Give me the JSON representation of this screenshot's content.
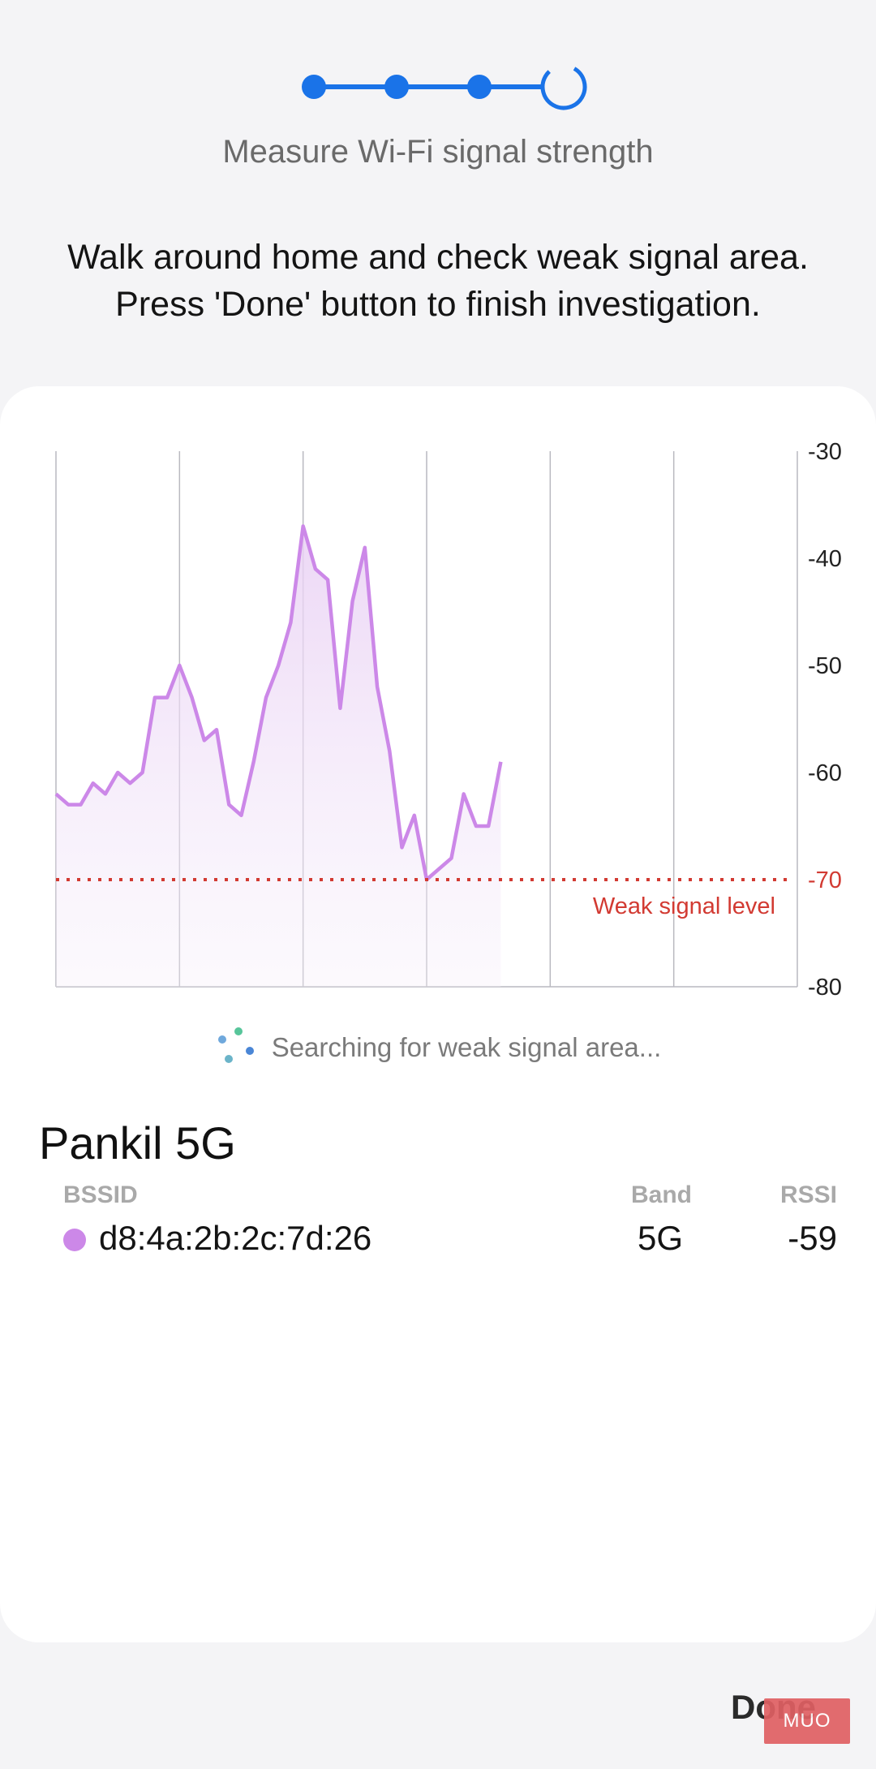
{
  "header": {
    "steps_total": 4,
    "steps_completed": 3,
    "accent_color": "#1a73e8",
    "subtitle": "Measure Wi-Fi signal strength"
  },
  "instruction": {
    "line1": "Walk around home and check weak signal area.",
    "line2": "Press 'Done' button to finish investigation."
  },
  "chart_data": {
    "type": "area",
    "ylim": [
      -80,
      -30
    ],
    "yticks": [
      -30,
      -40,
      -50,
      -60,
      -70,
      -80
    ],
    "xlim": [
      0,
      60
    ],
    "vertical_gridlines": [
      0,
      10,
      20,
      30,
      40,
      50,
      60
    ],
    "x": [
      0,
      1,
      2,
      3,
      4,
      5,
      6,
      7,
      8,
      9,
      10,
      11,
      12,
      13,
      14,
      15,
      16,
      17,
      18,
      19,
      20,
      21,
      22,
      23,
      24,
      25,
      26,
      27,
      28,
      29,
      30,
      31,
      32,
      33,
      34,
      35,
      36
    ],
    "values": [
      -62,
      -63,
      -63,
      -61,
      -62,
      -60,
      -61,
      -60,
      -53,
      -53,
      -50,
      -53,
      -57,
      -56,
      -63,
      -64,
      -59,
      -53,
      -50,
      -46,
      -37,
      -41,
      -42,
      -54,
      -44,
      -39,
      -52,
      -58,
      -67,
      -64,
      -70,
      -69,
      -68,
      -62,
      -65,
      -65,
      -59
    ],
    "line_color": "#cc88e8",
    "weak_threshold": -70,
    "weak_color": "#d23a32",
    "weak_label": "Weak signal level"
  },
  "status": {
    "text": "Searching for weak signal area..."
  },
  "network": {
    "name": "Pankil 5G",
    "columns": {
      "bssid": "BSSID",
      "band": "Band",
      "rssi": "RSSI"
    },
    "row": {
      "bssid": "d8:4a:2b:2c:7d:26",
      "band": "5G",
      "rssi": "-59",
      "color": "#cc88e8"
    }
  },
  "footer": {
    "done_label": "Done",
    "watermark": "MUO"
  }
}
